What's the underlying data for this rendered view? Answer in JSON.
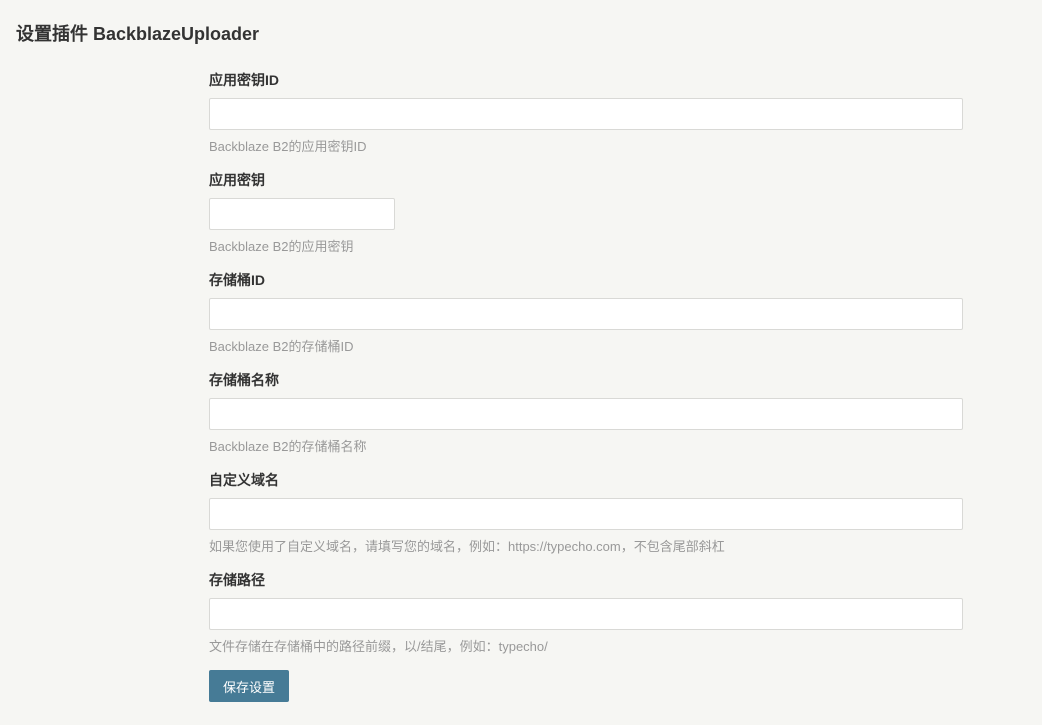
{
  "page": {
    "title": "设置插件 BackblazeUploader"
  },
  "form": {
    "fields": [
      {
        "label": "应用密钥ID",
        "value": "",
        "description": "Backblaze B2的应用密钥ID"
      },
      {
        "label": "应用密钥",
        "value": "",
        "description": "Backblaze B2的应用密钥"
      },
      {
        "label": "存储桶ID",
        "value": "",
        "description": "Backblaze B2的存储桶ID"
      },
      {
        "label": "存储桶名称",
        "value": "",
        "description": "Backblaze B2的存储桶名称"
      },
      {
        "label": "自定义域名",
        "value": "",
        "description": "如果您使用了自定义域名，请填写您的域名，例如：https://typecho.com，不包含尾部斜杠"
      },
      {
        "label": "存储路径",
        "value": "",
        "description": "文件存储在存储桶中的路径前缀，以/结尾，例如：typecho/"
      }
    ],
    "submit_label": "保存设置"
  },
  "colors": {
    "background": "#f6f6f3",
    "primary_button": "#467b96",
    "description_text": "#999999"
  }
}
